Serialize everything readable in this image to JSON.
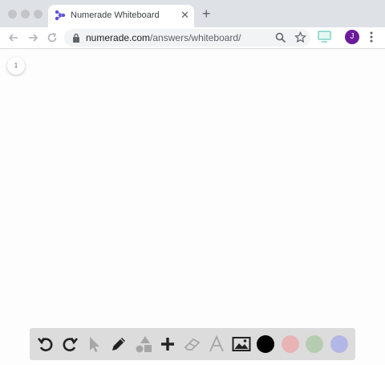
{
  "browser": {
    "tab": {
      "title": "Numerade Whiteboard",
      "close": "✕"
    },
    "new_tab": "+",
    "url_host": "numerade.com",
    "url_path": "/answers/whiteboard/",
    "avatar_initial": "J"
  },
  "whiteboard": {
    "page_number": "1"
  },
  "toolbar": {
    "tools": [
      "undo-icon",
      "redo-icon",
      "select-pointer-icon",
      "pencil-icon",
      "shapes-icon",
      "plus-icon",
      "eraser-icon",
      "text-icon",
      "image-icon"
    ],
    "colors": {
      "black": "#000000",
      "red": "#e8b4b4",
      "green": "#b5ccb0",
      "blue": "#b3b7e6"
    }
  }
}
